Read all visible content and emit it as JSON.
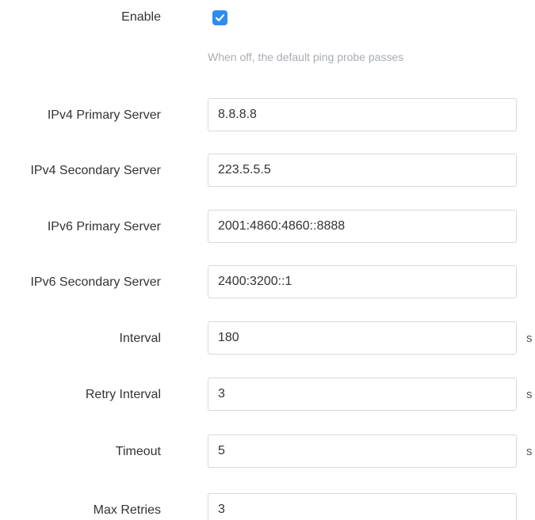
{
  "enable": {
    "label": "Enable",
    "checked": true,
    "hint": "When off, the default ping probe passes"
  },
  "fields": {
    "ipv4_primary": {
      "label": "IPv4 Primary Server",
      "value": "8.8.8.8"
    },
    "ipv4_secondary": {
      "label": "IPv4 Secondary Server",
      "value": "223.5.5.5"
    },
    "ipv6_primary": {
      "label": "IPv6 Primary Server",
      "value": "2001:4860:4860::8888"
    },
    "ipv6_secondary": {
      "label": "IPv6 Secondary Server",
      "value": "2400:3200::1"
    },
    "interval": {
      "label": "Interval",
      "value": "180",
      "unit": "s"
    },
    "retry_interval": {
      "label": "Retry Interval",
      "value": "3",
      "unit": "s"
    },
    "timeout": {
      "label": "Timeout",
      "value": "5",
      "unit": "s"
    },
    "max_retries": {
      "label": "Max Retries",
      "value": "3"
    }
  },
  "colors": {
    "checkbox": "#2d8cf0",
    "hint": "#a8acb3",
    "input_border": "#d9d9d9"
  },
  "icons": {
    "enable_checkbox": "check-icon"
  }
}
